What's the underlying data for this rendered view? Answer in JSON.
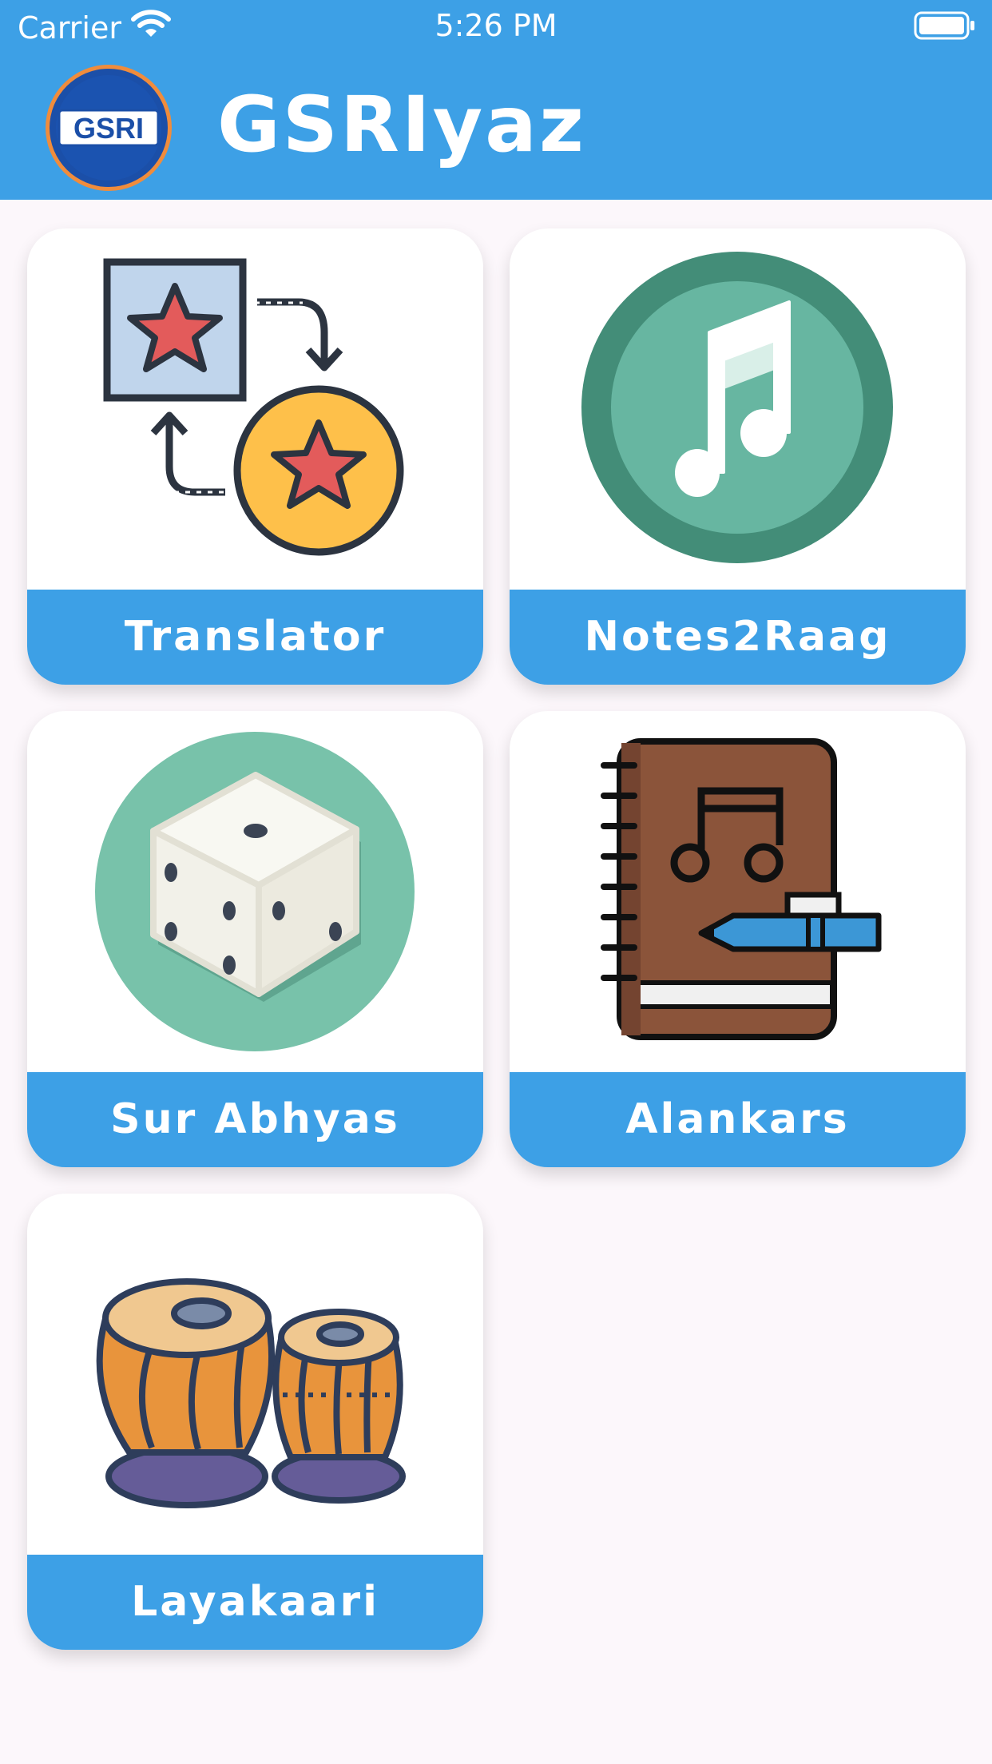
{
  "status_bar": {
    "carrier": "Carrier",
    "time": "5:26 PM"
  },
  "header": {
    "logo_text": "GSRI",
    "title": "GSRIyaz"
  },
  "tiles": [
    {
      "label": "Translator",
      "icon": "translate-stars-icon"
    },
    {
      "label": "Notes2Raag",
      "icon": "music-note-icon"
    },
    {
      "label": "Sur Abhyas",
      "icon": "dice-icon"
    },
    {
      "label": "Alankars",
      "icon": "music-notebook-icon"
    },
    {
      "label": "Layakaari",
      "icon": "tabla-icon"
    }
  ],
  "colors": {
    "header": "#3da0e6",
    "background": "#fcf7fb",
    "tile_label_bg": "#3da0e6"
  }
}
